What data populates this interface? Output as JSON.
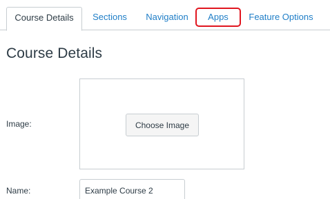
{
  "tabs": [
    {
      "label": "Course Details",
      "active": true
    },
    {
      "label": "Sections",
      "active": false
    },
    {
      "label": "Navigation",
      "active": false
    },
    {
      "label": "Apps",
      "active": false,
      "highlighted": true
    },
    {
      "label": "Feature Options",
      "active": false
    }
  ],
  "page_title": "Course Details",
  "form": {
    "image_label": "Image:",
    "choose_image_label": "Choose Image",
    "name_label": "Name:",
    "name_value": "Example Course 2"
  },
  "colors": {
    "link": "#1f7ec7",
    "text": "#2d3b45",
    "border": "#c7cdd1",
    "highlight": "#e0141e"
  }
}
